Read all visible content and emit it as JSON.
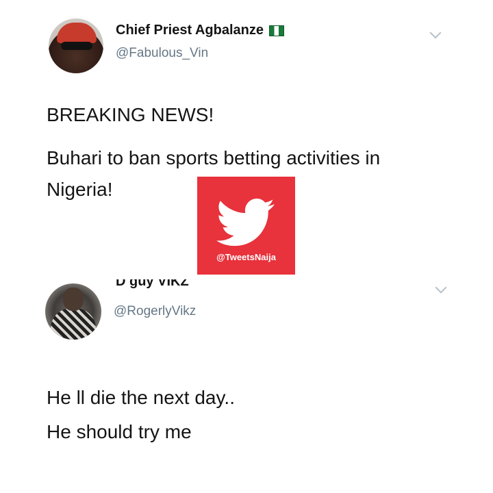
{
  "tweet1": {
    "display_name": "Chief Priest Agbalanze",
    "flag_icon": "nigeria-flag-icon",
    "handle": "@Fabulous_Vin",
    "headline": "BREAKING NEWS!",
    "line1": "Buhari to ban sports betting activities in",
    "line2": "Nigeria!"
  },
  "tweet2": {
    "display_name_partial": "D guy VIKZ",
    "handle": "@RogerlyVikz",
    "line1": "He ll die the next day..",
    "line2": "He should try me"
  },
  "watermark": {
    "label": "@TweetsNaija",
    "icon": "twitter-bird-icon",
    "color": "#e8323c"
  },
  "colors": {
    "handle": "#657786",
    "text": "#141414",
    "chevron": "#b7c1c9"
  }
}
